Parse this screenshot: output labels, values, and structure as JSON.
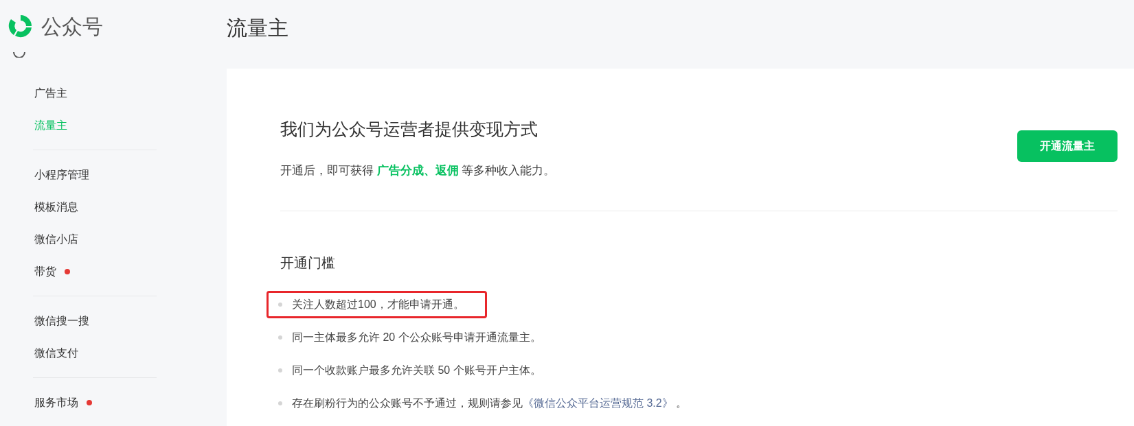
{
  "logo": {
    "text": "公众号"
  },
  "page_title": "流量主",
  "sidebar": {
    "groups": [
      {
        "items": [
          {
            "label": "广告主",
            "selected": false,
            "badge": false
          },
          {
            "label": "流量主",
            "selected": true,
            "badge": false
          }
        ]
      },
      {
        "items": [
          {
            "label": "小程序管理",
            "selected": false,
            "badge": false
          },
          {
            "label": "模板消息",
            "selected": false,
            "badge": false
          },
          {
            "label": "微信小店",
            "selected": false,
            "badge": false
          },
          {
            "label": "带货",
            "selected": false,
            "badge": true
          }
        ]
      },
      {
        "items": [
          {
            "label": "微信搜一搜",
            "selected": false,
            "badge": false
          },
          {
            "label": "微信支付",
            "selected": false,
            "badge": false
          }
        ]
      },
      {
        "items": [
          {
            "label": "服务市场",
            "selected": false,
            "badge": true
          }
        ]
      }
    ]
  },
  "intro": {
    "heading": "我们为公众号运营者提供变现方式",
    "description": [
      {
        "kind": "plain",
        "text": "开通后，即可获得 "
      },
      {
        "kind": "highlight",
        "text": "广告分成、返佣"
      },
      {
        "kind": "plain",
        "text": " 等多种收入能力。"
      }
    ],
    "button": "开通流量主"
  },
  "requirements": {
    "heading": "开通门槛",
    "items": [
      {
        "highlighted": true,
        "parts": [
          {
            "kind": "plain",
            "text": "关注人数超过100，才能申请开通。"
          }
        ]
      },
      {
        "highlighted": false,
        "parts": [
          {
            "kind": "plain",
            "text": "同一主体最多允许 20 个公众账号申请开通流量主。"
          }
        ]
      },
      {
        "highlighted": false,
        "parts": [
          {
            "kind": "plain",
            "text": "同一个收款账户最多允许关联 50 个账号开户主体。"
          }
        ]
      },
      {
        "highlighted": false,
        "parts": [
          {
            "kind": "plain",
            "text": "存在刷粉行为的公众账号不予通过，规则请参见"
          },
          {
            "kind": "link",
            "text": "《微信公众平台运营规范 3.2》"
          },
          {
            "kind": "plain",
            "text": " 。"
          }
        ]
      }
    ]
  }
}
